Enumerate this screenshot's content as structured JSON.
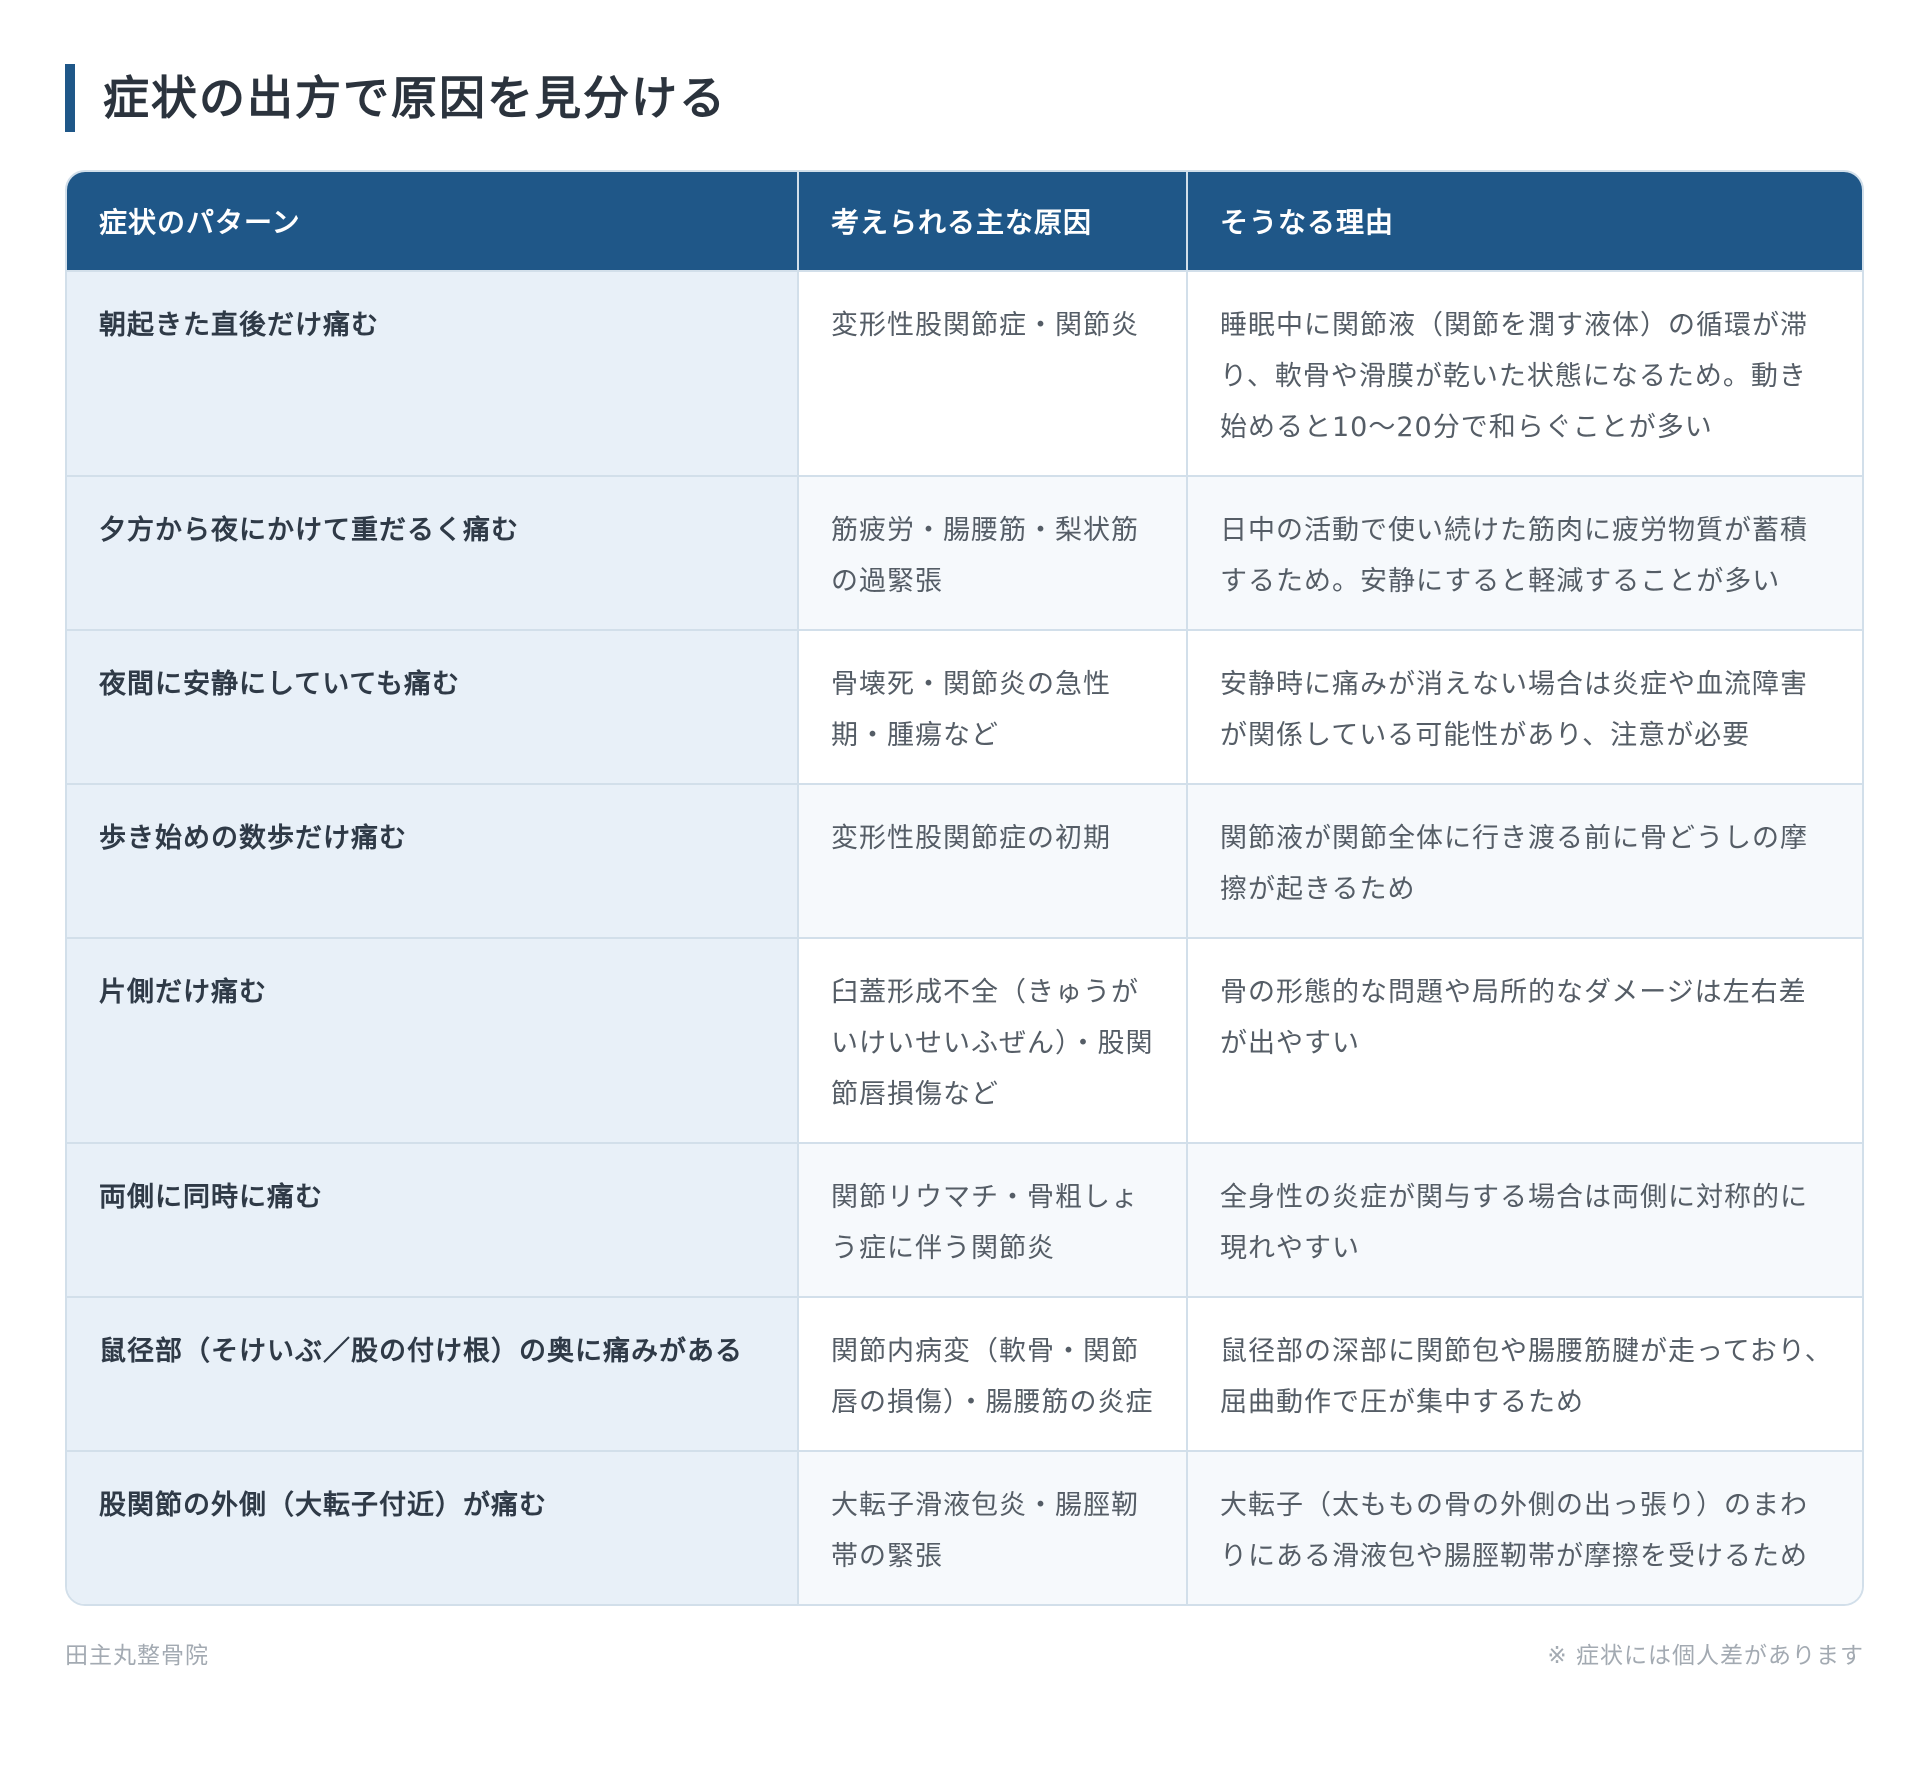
{
  "title": "症状の出方で原因を見分ける",
  "table": {
    "headers": [
      "症状のパターン",
      "考えられる主な原因",
      "そうなる理由"
    ],
    "rows": [
      {
        "pattern": "朝起きた直後だけ痛む",
        "cause": "変形性股関節症・関節炎",
        "reason": "睡眠中に関節液（関節を潤す液体）の循環が滞り、軟骨や滑膜が乾いた状態になるため。動き始めると10〜20分で和らぐことが多い"
      },
      {
        "pattern": "夕方から夜にかけて重だるく痛む",
        "cause": "筋疲労・腸腰筋・梨状筋の過緊張",
        "reason": "日中の活動で使い続けた筋肉に疲労物質が蓄積するため。安静にすると軽減することが多い"
      },
      {
        "pattern": "夜間に安静にしていても痛む",
        "cause": "骨壊死・関節炎の急性期・腫瘍など",
        "reason": "安静時に痛みが消えない場合は炎症や血流障害が関係している可能性があり、注意が必要"
      },
      {
        "pattern": "歩き始めの数歩だけ痛む",
        "cause": "変形性股関節症の初期",
        "reason": "関節液が関節全体に行き渡る前に骨どうしの摩擦が起きるため"
      },
      {
        "pattern": "片側だけ痛む",
        "cause": "臼蓋形成不全（きゅうがいけいせいふぜん）・股関節唇損傷など",
        "reason": "骨の形態的な問題や局所的なダメージは左右差が出やすい"
      },
      {
        "pattern": "両側に同時に痛む",
        "cause": "関節リウマチ・骨粗しょう症に伴う関節炎",
        "reason": "全身性の炎症が関与する場合は両側に対称的に現れやすい"
      },
      {
        "pattern": "鼠径部（そけいぶ／股の付け根）の奥に痛みがある",
        "cause": "関節内病変（軟骨・関節唇の損傷）・腸腰筋の炎症",
        "reason": "鼠径部の深部に関節包や腸腰筋腱が走っており、屈曲動作で圧が集中するため"
      },
      {
        "pattern": "股関節の外側（大転子付近）が痛む",
        "cause": "大転子滑液包炎・腸脛靭帯の緊張",
        "reason": "大転子（太ももの骨の外側の出っ張り）のまわりにある滑液包や腸脛靭帯が摩擦を受けるため"
      }
    ]
  },
  "footer": {
    "clinic": "田主丸整骨院",
    "note": "※ 症状には個人差があります"
  },
  "colors": {
    "header_bg": "#1f5788",
    "accent_bar": "#1f5788",
    "pattern_cell_bg": "#e8f0f8",
    "border": "#d2dfea"
  }
}
